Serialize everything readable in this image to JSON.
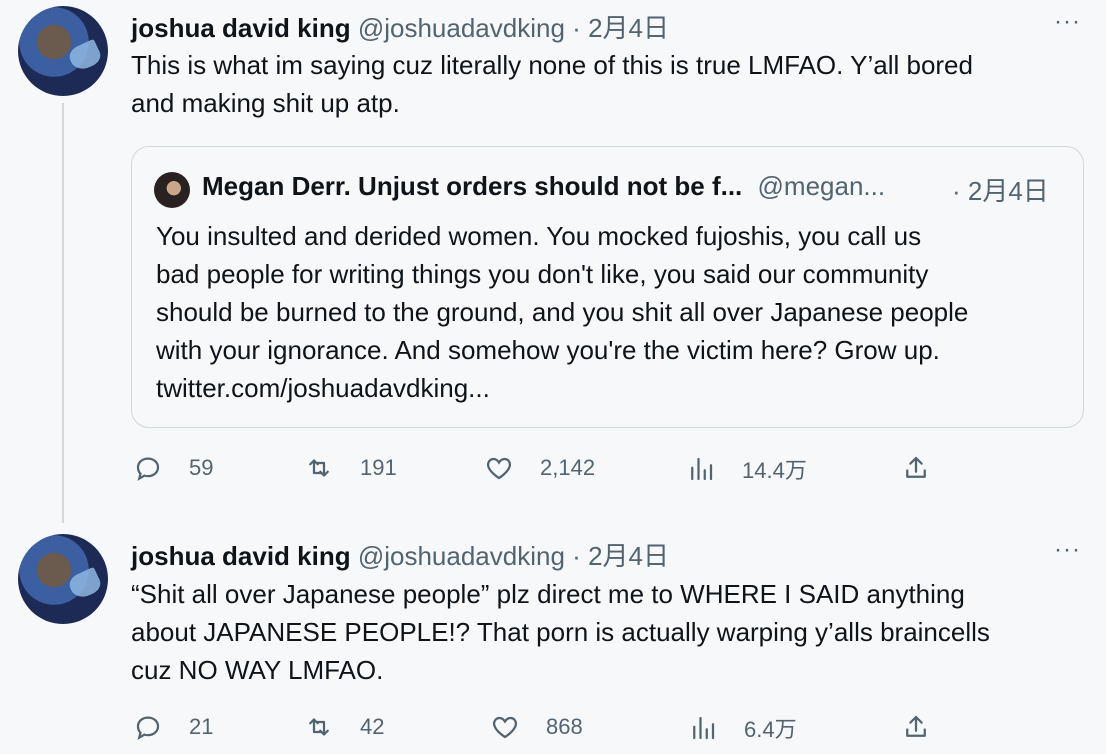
{
  "tweets": [
    {
      "name": "joshua david king",
      "handle": "@joshuadavdking",
      "dot": "·",
      "date": "2月4日",
      "more": "···",
      "text_lines": [
        "This is what im saying cuz literally none of this is true LMFAO. Y’all bored",
        "and making shit up atp."
      ],
      "quote": {
        "name": "Megan Derr. Unjust orders should not be f...",
        "handle": "@megan...",
        "date": "· 2月4日",
        "text_lines": [
          "You insulted and derided women. You mocked fujoshis, you call us",
          "bad people for writing things you don't like, you said our community",
          "should be burned to the ground, and you shit all over Japanese people",
          "with your ignorance. And somehow you're the victim here? Grow up.",
          "twitter.com/joshuadavdking..."
        ]
      },
      "actions": {
        "replies": "59",
        "retweets": "191",
        "likes": "2,142",
        "views": "14.4万"
      }
    },
    {
      "name": "joshua david king",
      "handle": "@joshuadavdking",
      "dot": "·",
      "date": "2月4日",
      "more": "···",
      "text_lines": [
        "“Shit all over Japanese people” plz direct me to WHERE I SAID anything",
        "about JAPANESE PEOPLE!? That porn is actually warping y’alls braincells",
        "cuz NO WAY LMFAO."
      ],
      "actions": {
        "replies": "21",
        "retweets": "42",
        "likes": "868",
        "views": "6.4万"
      }
    }
  ],
  "icons": {
    "reply": "reply-icon",
    "retweet": "retweet-icon",
    "like": "heart-icon",
    "views": "analytics-icon",
    "share": "share-icon"
  }
}
